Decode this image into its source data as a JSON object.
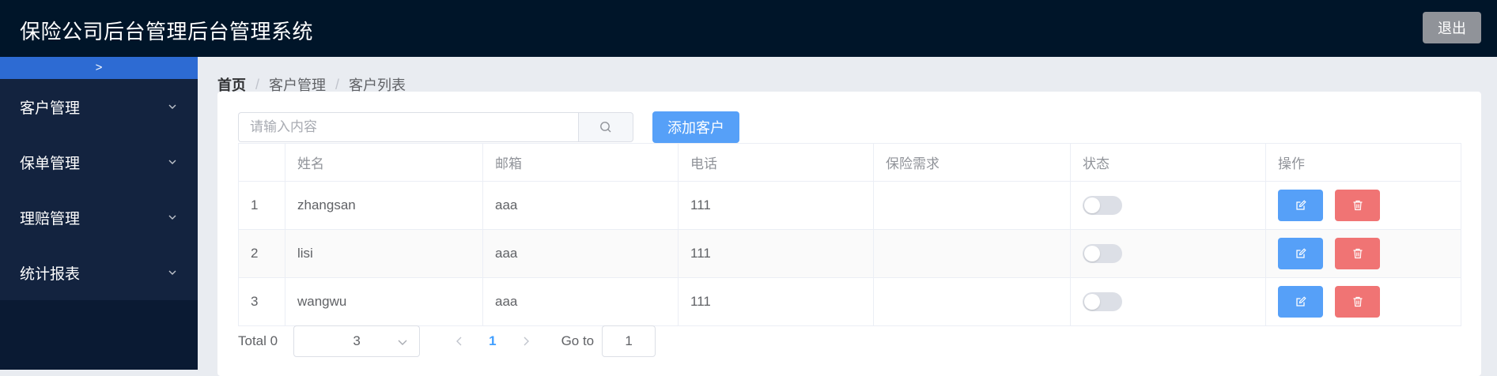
{
  "header": {
    "title": "保险公司后台管理后台管理系统",
    "logout_label": "退出"
  },
  "sidebar": {
    "collapse_label": ">",
    "items": [
      {
        "label": "客户管理"
      },
      {
        "label": "保单管理"
      },
      {
        "label": "理赔管理"
      },
      {
        "label": "统计报表"
      }
    ]
  },
  "breadcrumb": {
    "home": "首页",
    "section": "客户管理",
    "page": "客户列表",
    "separator": "/"
  },
  "toolbar": {
    "search_placeholder": "请输入内容",
    "add_label": "添加客户"
  },
  "table": {
    "headers": [
      "",
      "姓名",
      "邮箱",
      "电话",
      "保险需求",
      "状态",
      "操作"
    ],
    "rows": [
      {
        "index": "1",
        "name": "zhangsan",
        "email": "aaa",
        "phone": "111",
        "need": "",
        "status": false
      },
      {
        "index": "2",
        "name": "lisi",
        "email": "aaa",
        "phone": "111",
        "need": "",
        "status": false
      },
      {
        "index": "3",
        "name": "wangwu",
        "email": "aaa",
        "phone": "111",
        "need": "",
        "status": false
      }
    ]
  },
  "pagination": {
    "total_label": "Total 0",
    "page_size": "3",
    "current_page": "1",
    "goto_label": "Go to",
    "goto_value": "1"
  },
  "colors": {
    "header_bg": "#001529",
    "sidebar_bg": "#13233f",
    "accent": "#56a0f8",
    "danger": "#f07474",
    "collapse_bar": "#2d6bd3"
  }
}
